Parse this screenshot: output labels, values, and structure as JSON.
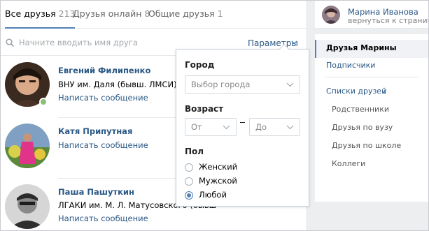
{
  "tabs": [
    {
      "label": "Все друзья",
      "count": "213"
    },
    {
      "label": "Друзья онлайн",
      "count": "8"
    },
    {
      "label": "Общие друзья",
      "count": "1"
    }
  ],
  "search": {
    "placeholder": "Начните вводить имя друга",
    "params_label": "Параметры"
  },
  "friends": [
    {
      "name": "Евгений Филипенко",
      "info": "ВНУ им. Даля (бывш. ЛМСИ)",
      "message": "Написать сообщение",
      "online": true
    },
    {
      "name": "Катя Припутная",
      "info": "",
      "message": "Написать сообщение",
      "online": false
    },
    {
      "name": "Паша Пашуткин",
      "info": "ЛГАКИ им. М. Л. Матусовского (бывш",
      "message": "Написать сообщение",
      "online": false
    }
  ],
  "filters": {
    "city_label": "Город",
    "city_placeholder": "Выбор города",
    "age_label": "Возраст",
    "age_from": "От",
    "age_separator": "–",
    "age_to": "До",
    "gender_label": "Пол",
    "gender_options": [
      "Женский",
      "Мужской",
      "Любой"
    ],
    "gender_selected": "Любой"
  },
  "sidebar": {
    "owner_name": "Марина Иванова",
    "back_link": "вернуться к странице",
    "menu": [
      "Друзья Марины",
      "Подписчики"
    ],
    "lists_label": "Списки друзей",
    "lists": [
      "Родственники",
      "Друзья по вузу",
      "Друзья по школе",
      "Коллеги"
    ]
  },
  "colors": {
    "accent": "#5181b8",
    "link": "#2a5885",
    "online": "#8ac176",
    "background": "#edeef0"
  },
  "icons": {
    "search": "search-icon",
    "params": "chevron-down-icon",
    "select": "chevron-down-icon",
    "lists": "caret-up-icon"
  }
}
